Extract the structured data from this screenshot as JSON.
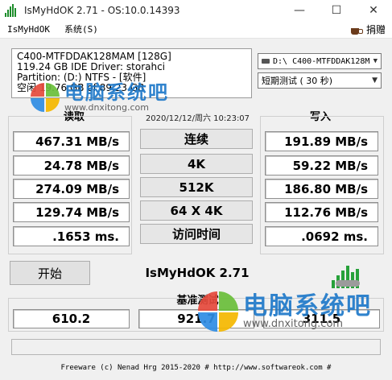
{
  "window": {
    "title": "IsMyHdOK 2.71 - OS:10.0.14393",
    "minimize_glyph": "—",
    "maximize_glyph": "☐",
    "close_glyph": "✕"
  },
  "menu": {
    "items": [
      "IsMyHdOK",
      "系统(S)"
    ],
    "donate": "捐赠"
  },
  "drive_info": {
    "model": "C400-MTFDDAK128MAM [128G]",
    "capacity_driver": "119.24 GB  IDE Driver: storahci",
    "partition": "Partition: (D:) NTFS - [软件]",
    "free": "空闲 19.76 GB of 89.23 GB"
  },
  "controls": {
    "drive_select": "D:\\ C400-MTFDDAK128M",
    "test_select": "短期测试 ( 30 秒)"
  },
  "headers": {
    "read": "读取",
    "write": "写入",
    "timestamp": "2020/12/12/周六 10:23:07"
  },
  "tests": [
    {
      "label": "连续",
      "read": "467.31 MB/s",
      "write": "191.89 MB/s"
    },
    {
      "label": "4K",
      "read": "24.78 MB/s",
      "write": "59.22 MB/s"
    },
    {
      "label": "512K",
      "read": "274.09 MB/s",
      "write": "186.80 MB/s"
    },
    {
      "label": "64 X 4K",
      "read": "129.74 MB/s",
      "write": "112.76 MB/s"
    },
    {
      "label": "访问时间",
      "read": ".1653 ms.",
      "write": ".0692 ms."
    }
  ],
  "start_button": "开始",
  "app_name": "IsMyHdOK 2.71",
  "benchmark": {
    "label": "基准测试",
    "read_score": "610.2",
    "total_score": "921.7",
    "write_score": "311.5"
  },
  "footer": "Freeware (c) Nenad Hrg 2015-2020 # http://www.softwareok.com   #",
  "watermark": {
    "text": "电脑系统吧",
    "url": "www.dnxitong.com"
  },
  "colors": {
    "brand_green": "#1c8c2a",
    "watermark_blue": "#1f79c9"
  }
}
